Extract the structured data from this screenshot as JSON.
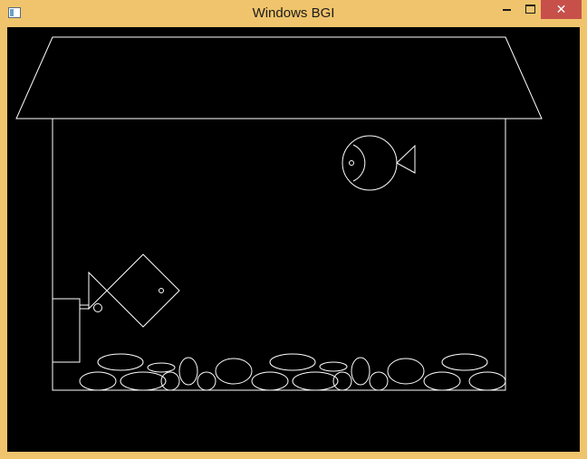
{
  "window": {
    "title": "Windows BGI",
    "frame_color": "#f0c46c",
    "close_color": "#c7504b",
    "canvas_background": "#000000",
    "drawing_color": "#ffffff"
  },
  "controls": {
    "minimize_icon": "minimize-icon",
    "maximize_icon": "maximize-icon",
    "close_icon": "close-icon",
    "close_glyph": "✕"
  }
}
